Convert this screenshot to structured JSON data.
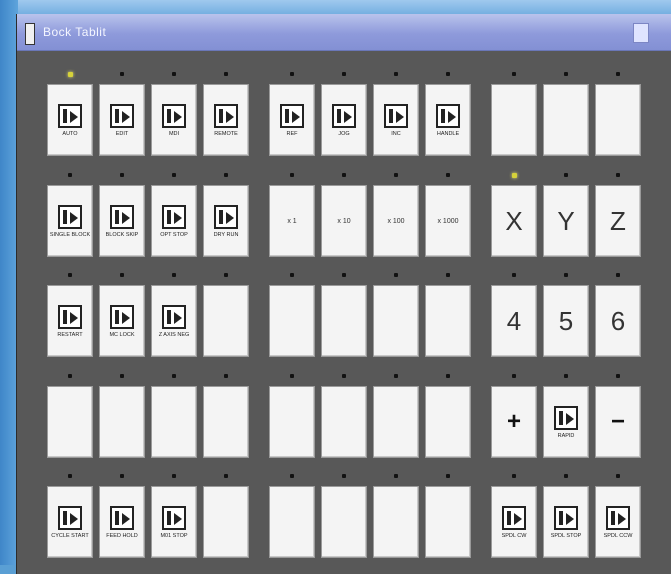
{
  "window": {
    "title": "Bock Tablit"
  },
  "rows": [
    [
      {
        "label": "AUTO",
        "glyph": "key-icon",
        "led": "on"
      },
      {
        "label": "EDIT",
        "glyph": "key-icon",
        "led": "off"
      },
      {
        "label": "MDI",
        "glyph": "key-icon",
        "led": "off"
      },
      {
        "label": "REMOTE",
        "glyph": "key-icon",
        "led": "off"
      },
      {
        "label": "REF",
        "glyph": "key-icon",
        "led": "off"
      },
      {
        "label": "JOG",
        "glyph": "key-icon",
        "led": "off"
      },
      {
        "label": "INC",
        "glyph": "key-icon",
        "led": "off"
      },
      {
        "label": "HANDLE",
        "glyph": "key-icon",
        "led": "off"
      },
      {
        "label": "",
        "led": "off"
      },
      {
        "label": "",
        "led": "off"
      },
      {
        "label": "",
        "led": "off"
      }
    ],
    [
      {
        "label": "SINGLE BLOCK",
        "glyph": "key-icon",
        "led": "off"
      },
      {
        "label": "BLOCK SKIP",
        "glyph": "key-icon",
        "led": "off"
      },
      {
        "label": "OPT STOP",
        "glyph": "key-icon",
        "led": "off"
      },
      {
        "label": "DRY RUN",
        "glyph": "key-icon",
        "led": "off"
      },
      {
        "label": "x 1",
        "led": "off",
        "style": "mid"
      },
      {
        "label": "x 10",
        "led": "off",
        "style": "mid"
      },
      {
        "label": "x 100",
        "led": "off",
        "style": "mid"
      },
      {
        "label": "x 1000",
        "led": "off",
        "style": "mid"
      },
      {
        "label": "X",
        "led": "on",
        "style": "big"
      },
      {
        "label": "Y",
        "led": "off",
        "style": "big"
      },
      {
        "label": "Z",
        "led": "off",
        "style": "big"
      }
    ],
    [
      {
        "label": "RESTART",
        "glyph": "key-icon",
        "led": "off"
      },
      {
        "label": "MC LOCK",
        "glyph": "key-icon",
        "led": "off"
      },
      {
        "label": "Z AXIS NEG",
        "glyph": "key-icon",
        "led": "off"
      },
      {
        "label": "",
        "led": "off"
      },
      {
        "label": "",
        "led": "off"
      },
      {
        "label": "",
        "led": "off"
      },
      {
        "label": "",
        "led": "off"
      },
      {
        "label": "",
        "led": "off"
      },
      {
        "label": "4",
        "led": "off",
        "style": "big"
      },
      {
        "label": "5",
        "led": "off",
        "style": "big"
      },
      {
        "label": "6",
        "led": "off",
        "style": "big"
      }
    ],
    [
      {
        "label": "",
        "led": "off"
      },
      {
        "label": "",
        "led": "off"
      },
      {
        "label": "",
        "led": "off"
      },
      {
        "label": "",
        "led": "off"
      },
      {
        "label": "",
        "led": "off"
      },
      {
        "label": "",
        "led": "off"
      },
      {
        "label": "",
        "led": "off"
      },
      {
        "label": "",
        "led": "off"
      },
      {
        "label": "+",
        "led": "off",
        "style": "math"
      },
      {
        "label": "RAPID",
        "glyph": "rapid-icon",
        "led": "off"
      },
      {
        "label": "−",
        "led": "off",
        "style": "math"
      }
    ],
    [
      {
        "label": "CYCLE START",
        "glyph": "key-icon",
        "led": "off"
      },
      {
        "label": "FEED HOLD",
        "glyph": "key-icon",
        "led": "off"
      },
      {
        "label": "M01 STOP",
        "glyph": "key-icon",
        "led": "off"
      },
      {
        "label": "",
        "led": "off"
      },
      {
        "label": "",
        "led": "off"
      },
      {
        "label": "",
        "led": "off"
      },
      {
        "label": "",
        "led": "off"
      },
      {
        "label": "",
        "led": "off"
      },
      {
        "label": "SPDL CW",
        "glyph": "spindle-icon",
        "led": "off"
      },
      {
        "label": "SPDL STOP",
        "glyph": "spindle-icon",
        "led": "off"
      },
      {
        "label": "SPDL CCW",
        "glyph": "spindle-icon",
        "led": "off"
      }
    ]
  ]
}
